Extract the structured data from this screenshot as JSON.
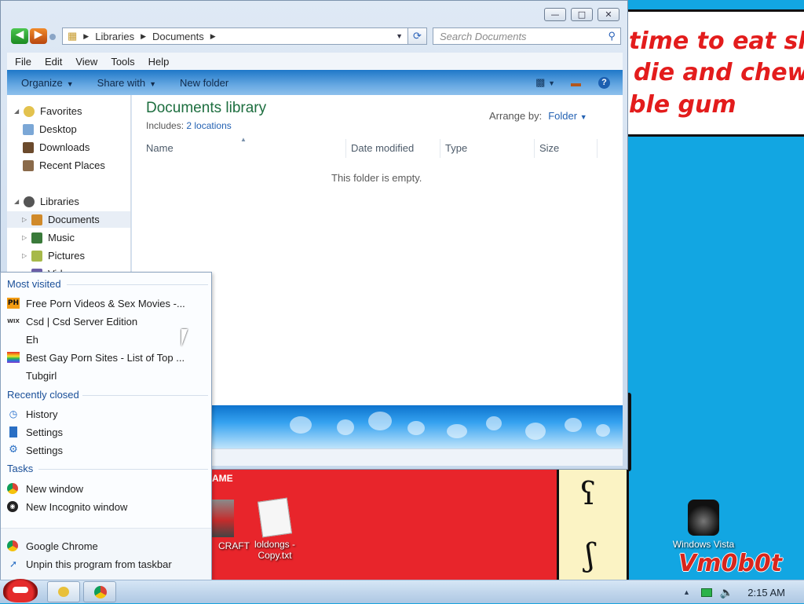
{
  "window": {
    "address_path": [
      "Libraries",
      "Documents"
    ],
    "search_placeholder": "Search Documents",
    "menu": [
      "File",
      "Edit",
      "View",
      "Tools",
      "Help"
    ],
    "toolbar": {
      "organize": "Organize",
      "share_with": "Share with",
      "new_folder": "New folder"
    },
    "nav": {
      "favorites": "Favorites",
      "desktop": "Desktop",
      "downloads": "Downloads",
      "recent_places": "Recent Places",
      "libraries": "Libraries",
      "documents": "Documents",
      "music": "Music",
      "pictures": "Pictures",
      "videos_partial": "Vid"
    },
    "content": {
      "title": "Documents library",
      "includes_label": "Includes:",
      "includes_link": "2 locations",
      "arrange_label": "Arrange by:",
      "arrange_value": "Folder",
      "columns": [
        "Name",
        "Date modified",
        "Type",
        "Size"
      ],
      "empty_message": "This folder is empty."
    }
  },
  "jumplist": {
    "most_visited_header": "Most visited",
    "most_visited": [
      {
        "icon": "PH",
        "label": "Free Porn Videos & Sex Movies -..."
      },
      {
        "icon": "WIX",
        "label": "Csd | Csd Server Edition"
      },
      {
        "icon": "",
        "label": "Eh"
      },
      {
        "icon": "rainbow",
        "label": "Best Gay Porn Sites - List of Top ..."
      },
      {
        "icon": "",
        "label": "Tubgirl"
      }
    ],
    "recently_closed_header": "Recently closed",
    "recently_closed": [
      "History",
      "Settings",
      "Settings"
    ],
    "tasks_header": "Tasks",
    "tasks": [
      "New window",
      "New Incognito window"
    ],
    "app": "Google Chrome",
    "unpin": "Unpin this program from taskbar"
  },
  "desktop": {
    "meme_lines": [
      "time to eat shit",
      "die and chew",
      "ble gum"
    ],
    "banner_partial": "AME",
    "icons": {
      "craft": "CRAFT",
      "loldongs": "loldongs - Copy.txt",
      "vista": "Windows Vista"
    },
    "watermark": "Vm0b0t"
  },
  "taskbar": {
    "clock": "2:15 AM"
  }
}
